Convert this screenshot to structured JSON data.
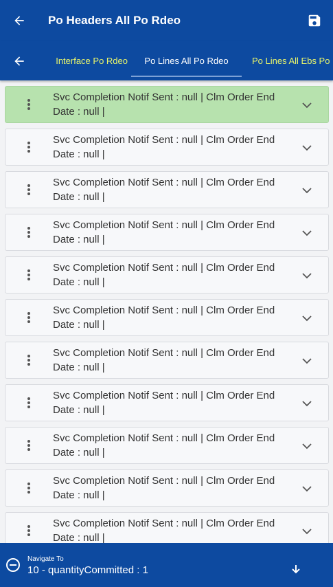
{
  "header": {
    "title": "Po Headers All Po Rdeo",
    "back_icon": "arrow-left-icon",
    "save_icon": "floppy-disk-icon"
  },
  "tabs": {
    "back_icon": "arrow-left-icon",
    "items": [
      {
        "label": "Interface Po Rdeo",
        "active": false
      },
      {
        "label": "Po Lines All Po Rdeo",
        "active": true
      },
      {
        "label": "Po Lines All Ebs Po Rdeo",
        "active": false
      }
    ]
  },
  "list": {
    "items": [
      {
        "line1": "Svc Completion Notif Sent  : null | Clm Order End",
        "line2": "Date  : null |",
        "selected": true
      },
      {
        "line1": "Svc Completion Notif Sent  : null | Clm Order End",
        "line2": "Date  : null |",
        "selected": false
      },
      {
        "line1": "Svc Completion Notif Sent  : null | Clm Order End",
        "line2": "Date  : null |",
        "selected": false
      },
      {
        "line1": "Svc Completion Notif Sent  : null | Clm Order End",
        "line2": "Date  : null |",
        "selected": false
      },
      {
        "line1": "Svc Completion Notif Sent  : null | Clm Order End",
        "line2": "Date  : null |",
        "selected": false
      },
      {
        "line1": "Svc Completion Notif Sent  : null | Clm Order End",
        "line2": "Date  : null |",
        "selected": false
      },
      {
        "line1": "Svc Completion Notif Sent  : null | Clm Order End",
        "line2": "Date  : null |",
        "selected": false
      },
      {
        "line1": "Svc Completion Notif Sent  : null | Clm Order End",
        "line2": "Date  : null |",
        "selected": false
      },
      {
        "line1": "Svc Completion Notif Sent  : null | Clm Order End",
        "line2": "Date  : null |",
        "selected": false
      },
      {
        "line1": "Svc Completion Notif Sent  : null | Clm Order End",
        "line2": "Date  : null |",
        "selected": false
      },
      {
        "line1": "Svc Completion Notif Sent  : null | Clm Order End",
        "line2": "Date  : null |",
        "selected": false
      }
    ]
  },
  "footer": {
    "label": "Navigate To",
    "value": "10 - quantityCommitted : 1"
  },
  "colors": {
    "primary": "#0d4aa0",
    "tab_inactive": "#e9f56a",
    "selected_row": "#b7e2ae"
  }
}
